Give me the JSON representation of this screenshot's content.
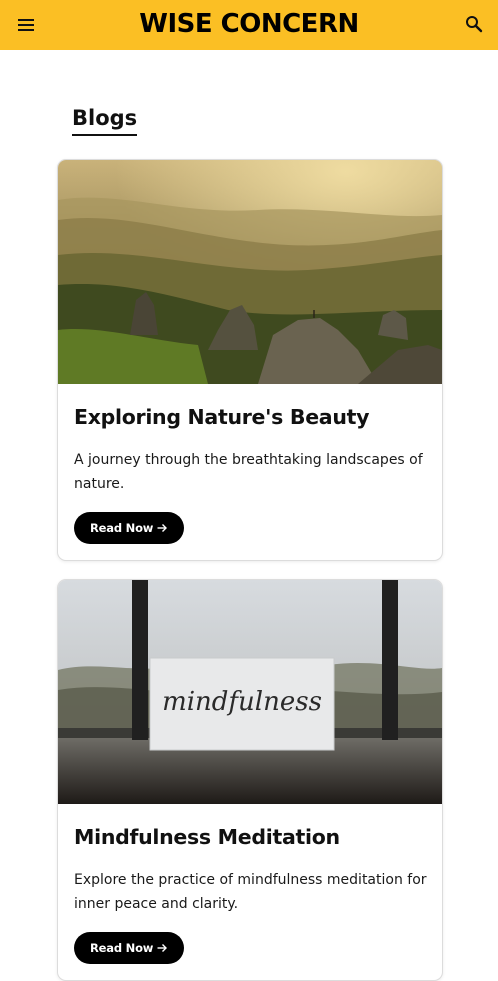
{
  "header": {
    "brand": "WISE CONCERN",
    "menu_icon": "hamburger-menu-icon",
    "search_icon": "search-icon",
    "background_color": "#fbbf24"
  },
  "main": {
    "section_title": "Blogs",
    "posts": [
      {
        "title": "Exploring Nature's Beauty",
        "description": "A journey through the breathtaking landscapes of nature.",
        "button_label": "Read Now",
        "button_icon": "arrow-right-icon"
      },
      {
        "title": "Mindfulness Meditation",
        "description": "Explore the practice of mindfulness meditation for inner peace and clarity.",
        "button_label": "Read Now",
        "button_icon": "arrow-right-icon",
        "image_text": "mindfulness"
      }
    ]
  },
  "colors": {
    "accent": "#fbbf24",
    "button": "#000000",
    "text": "#111111"
  }
}
